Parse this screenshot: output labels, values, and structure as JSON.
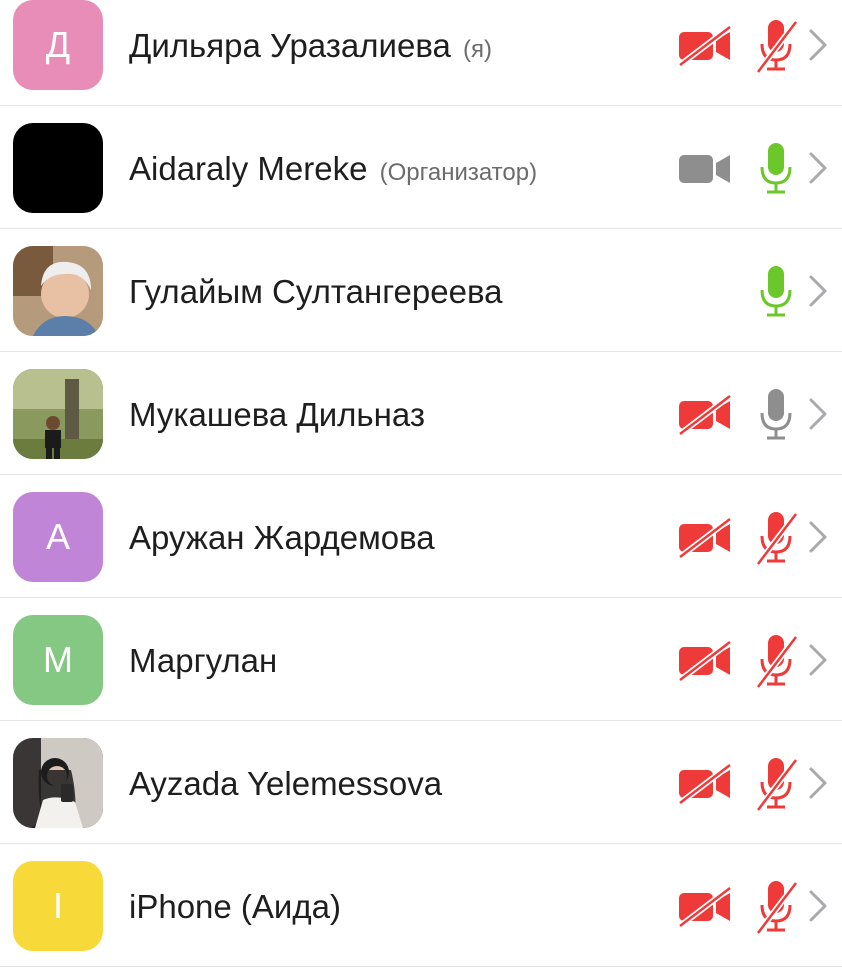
{
  "participants": [
    {
      "name": "Дильяра Уразалиева",
      "role": "(я)",
      "avatar": {
        "type": "letter",
        "letter": "Д",
        "color": "#e78db7"
      },
      "video": "off",
      "audio": "muted"
    },
    {
      "name": "Aidaraly Mereke",
      "role": "(Организатор)",
      "avatar": {
        "type": "solid",
        "letter": "",
        "color": "#000000"
      },
      "video": "on",
      "audio": "active"
    },
    {
      "name": "Гулайым Султангереева",
      "role": "",
      "avatar": {
        "type": "photo",
        "letter": "",
        "color": "#c8a888"
      },
      "video": "none",
      "audio": "active"
    },
    {
      "name": "Мукашева Дильназ",
      "role": "",
      "avatar": {
        "type": "photo",
        "letter": "",
        "color": "#6a7a48"
      },
      "video": "off",
      "audio": "unmuted"
    },
    {
      "name": "Аружан Жардемова",
      "role": "",
      "avatar": {
        "type": "letter",
        "letter": "А",
        "color": "#c185d8"
      },
      "video": "off",
      "audio": "muted"
    },
    {
      "name": "Маргулан",
      "role": "",
      "avatar": {
        "type": "letter",
        "letter": "М",
        "color": "#84c884"
      },
      "video": "off",
      "audio": "muted"
    },
    {
      "name": "Ayzada Yelemessova",
      "role": "",
      "avatar": {
        "type": "photo",
        "letter": "",
        "color": "#3a3636"
      },
      "video": "off",
      "audio": "muted"
    },
    {
      "name": "iPhone (Аида)",
      "role": "",
      "avatar": {
        "type": "letter",
        "letter": "I",
        "color": "#f7d93a"
      },
      "video": "off",
      "audio": "muted"
    }
  ],
  "colors": {
    "muted": "#ef3a3a",
    "active": "#6cc72a",
    "neutral": "#8e8e8e",
    "chevron": "#a9a9ae"
  },
  "icons": {
    "camera": "video-camera-icon",
    "camera_off": "video-off-icon",
    "mic": "microphone-icon",
    "mic_off": "microphone-muted-icon",
    "chevron": "chevron-right-icon"
  }
}
